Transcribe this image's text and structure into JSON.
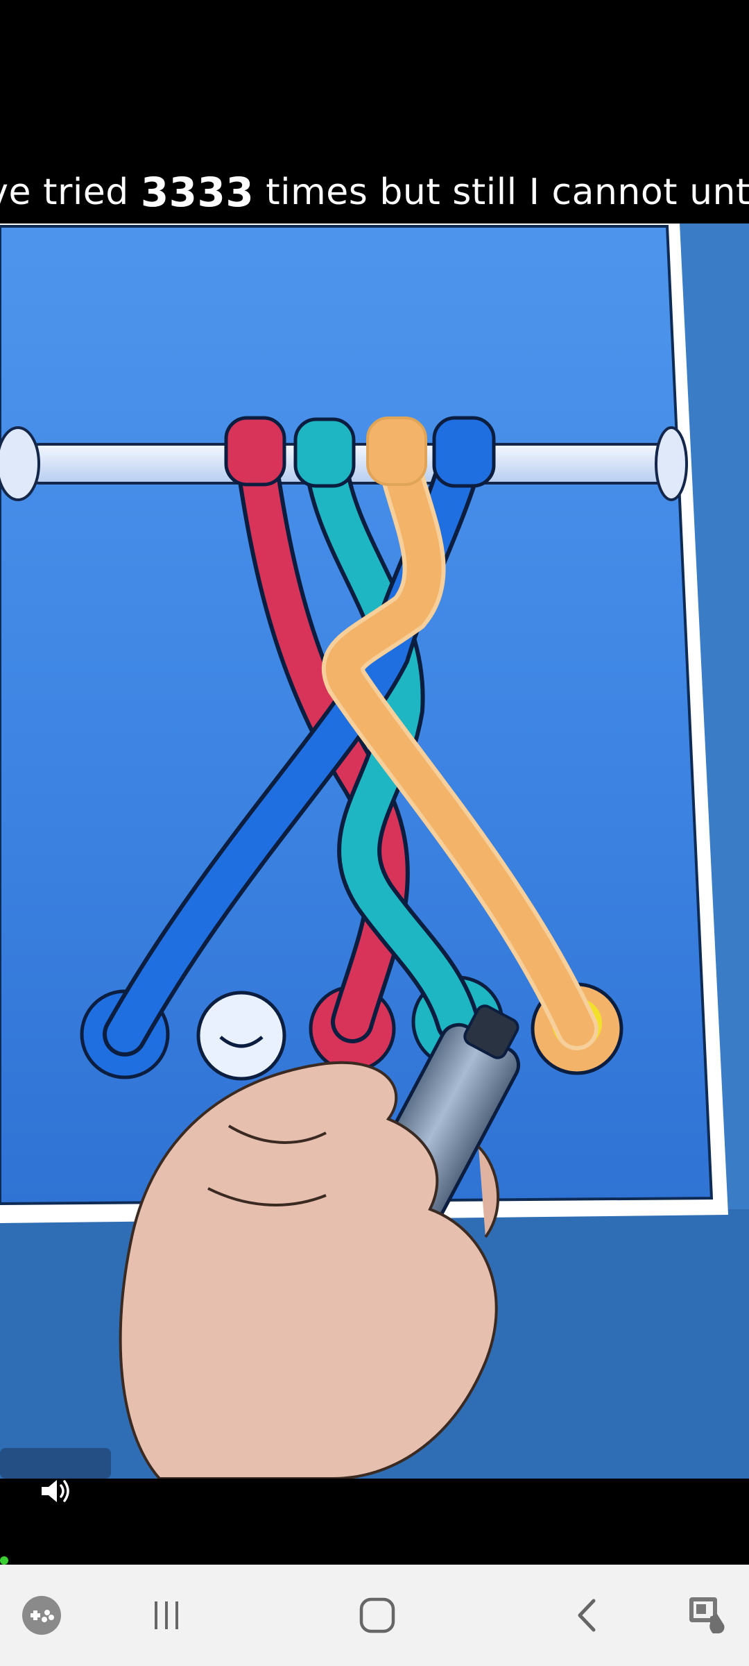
{
  "caption": {
    "before": "I've tried ",
    "number": "3333",
    "after": " times but still I cannot untie"
  },
  "player": {
    "volume_icon": "speaker-volume-icon"
  },
  "navbar": {
    "game_launcher_icon": "game-controller-icon",
    "recents_icon": "recent-apps-icon",
    "home_icon": "home-icon",
    "back_icon": "back-chevron-icon",
    "screenshot_icon": "screen-capture-icon"
  },
  "colors": {
    "board": "#3d86e6",
    "rope_red": "#d8345a",
    "rope_teal": "#1fb6c4",
    "rope_orange": "#f3b46a",
    "rope_blue": "#1f6fe0",
    "peg_yellow": "#f2e02a",
    "progress": "#3ccf33"
  }
}
